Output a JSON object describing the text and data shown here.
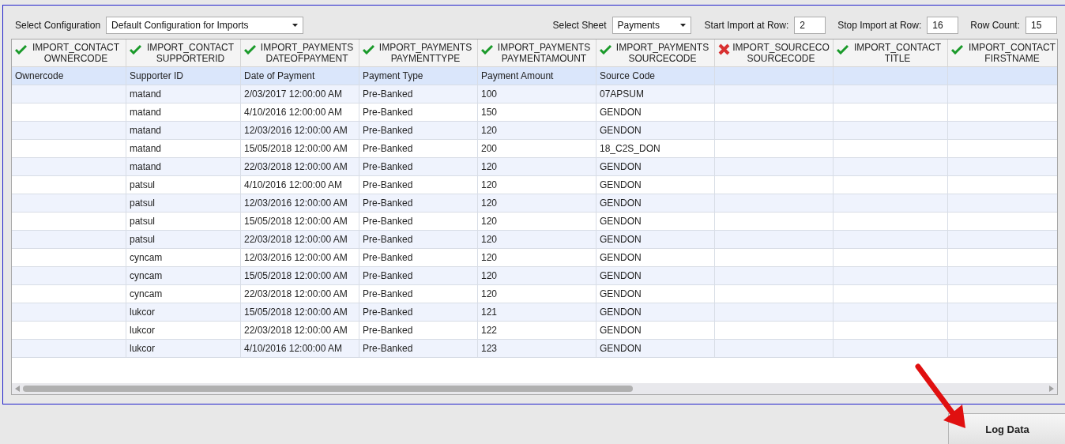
{
  "toolbar": {
    "configuration": {
      "label": "Select Configuration",
      "value": "Default Configuration for Imports"
    },
    "sheet": {
      "label": "Select Sheet",
      "value": "Payments"
    },
    "start_row": {
      "label": "Start Import at Row:",
      "value": "2"
    },
    "stop_row": {
      "label": "Stop Import at Row:",
      "value": "16"
    },
    "row_count": {
      "label": "Row Count:",
      "value": "15"
    }
  },
  "table": {
    "columns": [
      {
        "valid": true,
        "line1": "IMPORT_CONTACT",
        "line2": "OWNERCODE",
        "mapped": "Ownercode"
      },
      {
        "valid": true,
        "line1": "IMPORT_CONTACT",
        "line2": "SUPPORTERID",
        "mapped": "Supporter ID"
      },
      {
        "valid": true,
        "line1": "IMPORT_PAYMENTS",
        "line2": "DATEOFPAYMENT",
        "mapped": "Date of Payment"
      },
      {
        "valid": true,
        "line1": "IMPORT_PAYMENTS",
        "line2": "PAYMENTTYPE",
        "mapped": "Payment Type"
      },
      {
        "valid": true,
        "line1": "IMPORT_PAYMENTS",
        "line2": "PAYMENTAMOUNT",
        "mapped": "Payment Amount"
      },
      {
        "valid": true,
        "line1": "IMPORT_PAYMENTS",
        "line2": "SOURCECODE",
        "mapped": "Source Code"
      },
      {
        "valid": false,
        "line1": "IMPORT_SOURCECO",
        "line2": "SOURCECODE"
      },
      {
        "valid": true,
        "line1": "IMPORT_CONTACT",
        "line2": "TITLE"
      },
      {
        "valid": true,
        "line1": "IMPORT_CONTACT",
        "line2": "FIRSTNAME"
      }
    ],
    "rows": [
      [
        null,
        "matand",
        "2/03/2017 12:00:00 AM",
        "Pre-Banked",
        "100",
        "07APSUM",
        null,
        null,
        null
      ],
      [
        null,
        "matand",
        "4/10/2016 12:00:00 AM",
        "Pre-Banked",
        "150",
        "GENDON",
        null,
        null,
        null
      ],
      [
        null,
        "matand",
        "12/03/2016 12:00:00 AM",
        "Pre-Banked",
        "120",
        "GENDON",
        null,
        null,
        null
      ],
      [
        null,
        "matand",
        "15/05/2018 12:00:00 AM",
        "Pre-Banked",
        "200",
        "18_C2S_DON",
        null,
        null,
        null
      ],
      [
        null,
        "matand",
        "22/03/2018 12:00:00 AM",
        "Pre-Banked",
        "120",
        "GENDON",
        null,
        null,
        null
      ],
      [
        null,
        "patsul",
        "4/10/2016 12:00:00 AM",
        "Pre-Banked",
        "120",
        "GENDON",
        null,
        null,
        null
      ],
      [
        null,
        "patsul",
        "12/03/2016 12:00:00 AM",
        "Pre-Banked",
        "120",
        "GENDON",
        null,
        null,
        null
      ],
      [
        null,
        "patsul",
        "15/05/2018 12:00:00 AM",
        "Pre-Banked",
        "120",
        "GENDON",
        null,
        null,
        null
      ],
      [
        null,
        "patsul",
        "22/03/2018 12:00:00 AM",
        "Pre-Banked",
        "120",
        "GENDON",
        null,
        null,
        null
      ],
      [
        null,
        "cyncam",
        "12/03/2016 12:00:00 AM",
        "Pre-Banked",
        "120",
        "GENDON",
        null,
        null,
        null
      ],
      [
        null,
        "cyncam",
        "15/05/2018 12:00:00 AM",
        "Pre-Banked",
        "120",
        "GENDON",
        null,
        null,
        null
      ],
      [
        null,
        "cyncam",
        "22/03/2018 12:00:00 AM",
        "Pre-Banked",
        "120",
        "GENDON",
        null,
        null,
        null
      ],
      [
        null,
        "lukcor",
        "15/05/2018 12:00:00 AM",
        "Pre-Banked",
        "121",
        "GENDON",
        null,
        null,
        null
      ],
      [
        null,
        "lukcor",
        "22/03/2018 12:00:00 AM",
        "Pre-Banked",
        "122",
        "GENDON",
        null,
        null,
        null
      ],
      [
        null,
        "lukcor",
        "4/10/2016 12:00:00 AM",
        "Pre-Banked",
        "123",
        "GENDON",
        null,
        null,
        null
      ]
    ]
  },
  "log_button": "Log Data"
}
